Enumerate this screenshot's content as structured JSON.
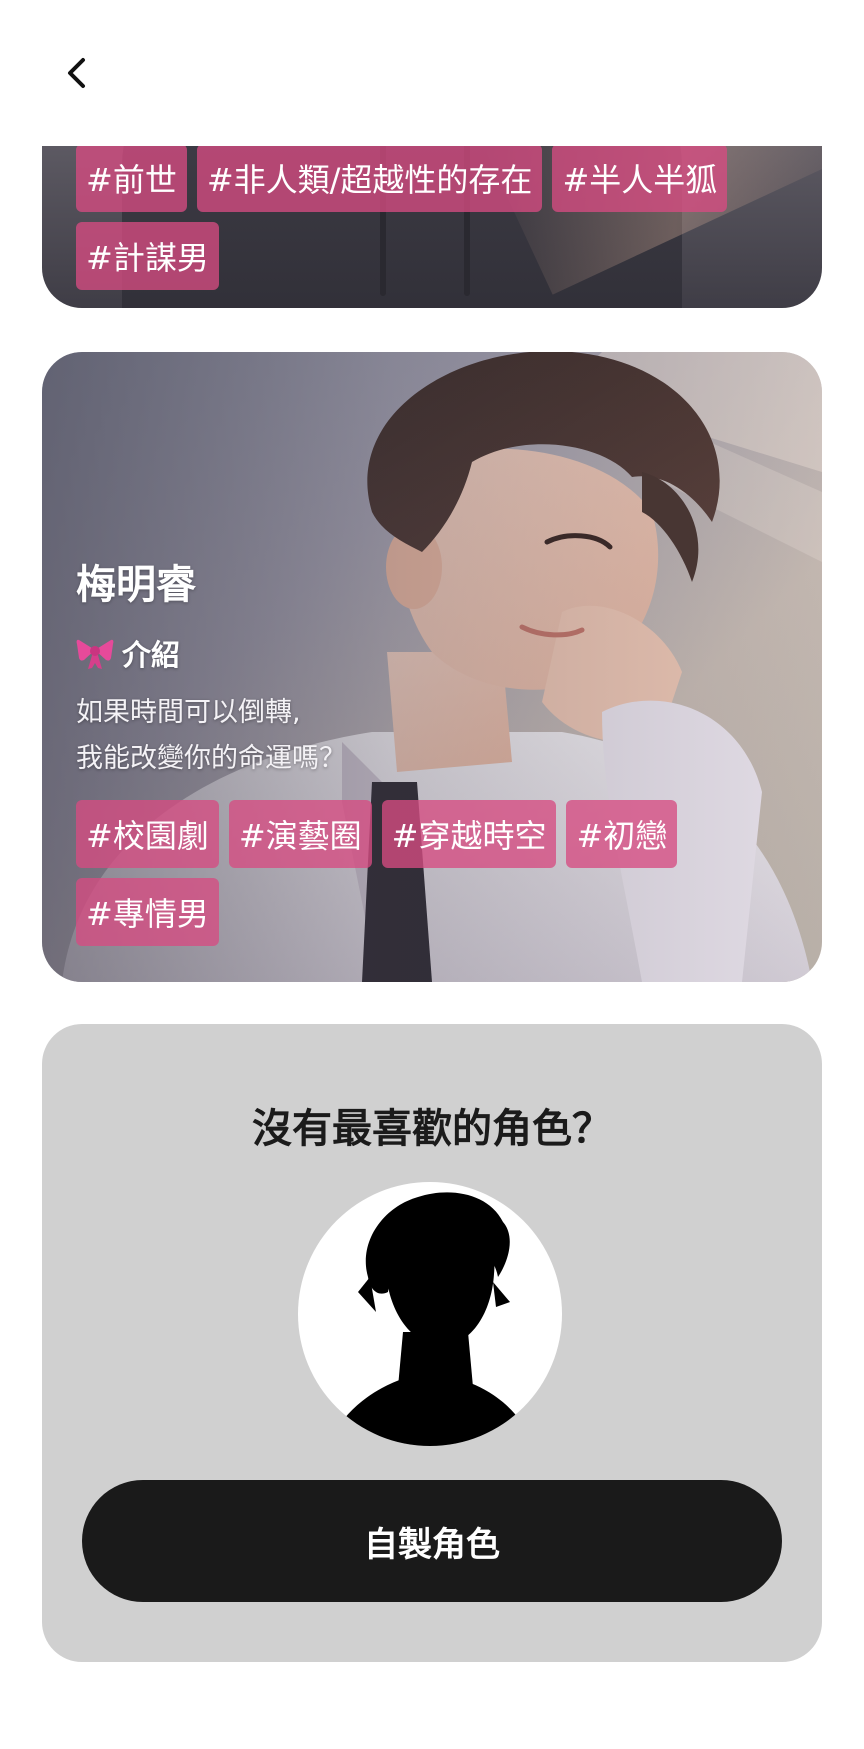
{
  "header": {
    "back_icon": "chevron-left-icon"
  },
  "card_top": {
    "tags": [
      "#前世",
      "#非人類/超越性的存在",
      "#半人半狐",
      "#計謀男"
    ]
  },
  "card_main": {
    "name": "梅明睿",
    "intro_icon": "ribbon-bow-icon",
    "intro_label": "介紹",
    "intro_lines": [
      "如果時間可以倒轉,",
      "我能改變你的命運嗎？"
    ],
    "tags": [
      "#校園劇",
      "#演藝圈",
      "#穿越時空",
      "#初戀",
      "#專情男"
    ]
  },
  "cta": {
    "title": "沒有最喜歡的角色？",
    "button_label": "自製角色"
  },
  "colors": {
    "tag_bg": "#d64c82",
    "cta_card_bg": "#d0d0d0",
    "button_bg": "#1a1a1a"
  }
}
